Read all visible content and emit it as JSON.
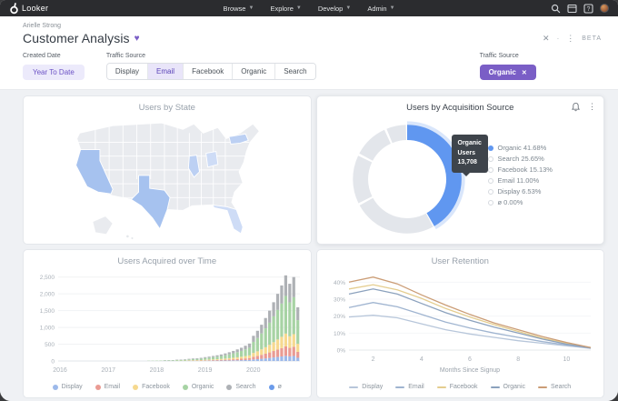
{
  "navbar": {
    "brand": "Looker",
    "menus": [
      {
        "label": "Browse"
      },
      {
        "label": "Explore"
      },
      {
        "label": "Develop"
      },
      {
        "label": "Admin"
      }
    ]
  },
  "header": {
    "author": "Arielle Strong",
    "title": "Customer Analysis",
    "favorite_icon": "♥",
    "beta_label": "BETA"
  },
  "filters": {
    "created_date": {
      "label": "Created Date",
      "value": "Year To Date"
    },
    "traffic_source_buttons": {
      "label": "Traffic Source",
      "options": [
        "Display",
        "Email",
        "Facebook",
        "Organic",
        "Search"
      ],
      "selected": "Email"
    },
    "traffic_source_chip": {
      "label": "Traffic Source",
      "value": "Organic"
    }
  },
  "chart_data": [
    {
      "type": "heatmap",
      "subtype": "us-choropleth",
      "title": "Users by State",
      "states": [
        {
          "code": "CA",
          "name": "California",
          "level": "high"
        },
        {
          "code": "TX",
          "name": "Texas",
          "level": "high"
        },
        {
          "code": "NY",
          "name": "New York",
          "level": "medium"
        },
        {
          "code": "IL",
          "name": "Illinois",
          "level": "medium"
        },
        {
          "code": "OH",
          "name": "Ohio",
          "level": "low"
        },
        {
          "code": "FL",
          "name": "Florida",
          "level": "low"
        }
      ],
      "palette": {
        "high": "#a6c2ef",
        "medium": "#bcd0f3",
        "low": "#cedcf6",
        "base": "#e9ebef"
      }
    },
    {
      "type": "pie",
      "subtype": "donut",
      "title": "Users by Acquisition Source",
      "segments": [
        {
          "label": "Organic",
          "pct": 41.68,
          "highlighted": true
        },
        {
          "label": "Search",
          "pct": 25.65
        },
        {
          "label": "Facebook",
          "pct": 15.13
        },
        {
          "label": "Email",
          "pct": 11.0
        },
        {
          "label": "Display",
          "pct": 6.53
        },
        {
          "label": "ø",
          "pct": 0.0
        }
      ],
      "colors": {
        "highlight": "#6097f0",
        "halo": "#d9e6fb",
        "muted": "#e3e6eb",
        "legend_muted": "#d6dadf"
      },
      "tooltip": {
        "title": "Organic",
        "subtitle": "Users",
        "value": "13,708"
      },
      "legend_position": "right"
    },
    {
      "type": "bar",
      "subtype": "stacked-monthly",
      "title": "Users Acquired over Time",
      "start_month": "2016-01",
      "totals": [
        1,
        1,
        1,
        1,
        2,
        2,
        2,
        2,
        3,
        3,
        3,
        4,
        4,
        5,
        5,
        6,
        7,
        8,
        9,
        10,
        12,
        14,
        16,
        18,
        22,
        26,
        30,
        34,
        40,
        46,
        52,
        60,
        68,
        78,
        88,
        100,
        115,
        130,
        150,
        170,
        195,
        225,
        260,
        300,
        345,
        395,
        455,
        520,
        750,
        900,
        1080,
        1280,
        1500,
        1750,
        2000,
        2250,
        2550,
        2300,
        2500,
        1600
      ],
      "series": [
        {
          "name": "Display",
          "share": 0.06,
          "color": "#9db9ea"
        },
        {
          "name": "Email",
          "share": 0.11,
          "color": "#ea9b93"
        },
        {
          "name": "Facebook",
          "share": 0.15,
          "color": "#f6d98f"
        },
        {
          "name": "Organic",
          "share": 0.44,
          "color": "#a7d3a4"
        },
        {
          "name": "Search",
          "share": 0.24,
          "color": "#aeb1b5"
        },
        {
          "name": "ø",
          "share": 0.0,
          "color": "#6b9bea"
        }
      ],
      "yticks": [
        {
          "v": 0,
          "label": "0"
        },
        {
          "v": 500,
          "label": "500"
        },
        {
          "v": 1000,
          "label": "1,000"
        },
        {
          "v": 1500,
          "label": "1,500"
        },
        {
          "v": 2000,
          "label": "2,000"
        },
        {
          "v": 2500,
          "label": "2,500"
        }
      ],
      "xticks": [
        {
          "label": "2016",
          "i": 0
        },
        {
          "label": "2017",
          "i": 12
        },
        {
          "label": "2018",
          "i": 24
        },
        {
          "label": "2019",
          "i": 36
        },
        {
          "label": "2020",
          "i": 48
        }
      ],
      "ylim": [
        0,
        2600
      ]
    },
    {
      "type": "line",
      "title": "User Retention",
      "xlabel": "Months Since Signup",
      "x": [
        1,
        2,
        3,
        4,
        5,
        6,
        7,
        8,
        9,
        10,
        11
      ],
      "series": [
        {
          "name": "Display",
          "color": "#b7c6da",
          "values": [
            19.5,
            20.5,
            19,
            15.5,
            12,
            9.5,
            7.5,
            5.5,
            4,
            2.5,
            1
          ]
        },
        {
          "name": "Email",
          "color": "#9fb4d0",
          "values": [
            25,
            28,
            25.5,
            21,
            16.5,
            13,
            10,
            7.5,
            5,
            3,
            1.2
          ]
        },
        {
          "name": "Facebook",
          "color": "#e4cd8f",
          "values": [
            36,
            38.5,
            35.5,
            30.5,
            24.5,
            19.5,
            15,
            11,
            7,
            4,
            1.5
          ]
        },
        {
          "name": "Organic",
          "color": "#8ba1bd",
          "values": [
            33,
            36,
            33,
            27.5,
            22,
            17.5,
            13.5,
            10,
            6.5,
            3.5,
            1.3
          ]
        },
        {
          "name": "Search",
          "color": "#cb9d76",
          "values": [
            40,
            43,
            39,
            32.5,
            26.5,
            21,
            16,
            12,
            8,
            4.5,
            1.5
          ]
        }
      ],
      "yticks": [
        {
          "v": 0,
          "label": "0%"
        },
        {
          "v": 10,
          "label": "10%"
        },
        {
          "v": 20,
          "label": "20%"
        },
        {
          "v": 30,
          "label": "30%"
        },
        {
          "v": 40,
          "label": "40%"
        }
      ],
      "xticks": [
        2,
        4,
        6,
        8,
        10
      ],
      "ylim": [
        0,
        45
      ]
    }
  ]
}
